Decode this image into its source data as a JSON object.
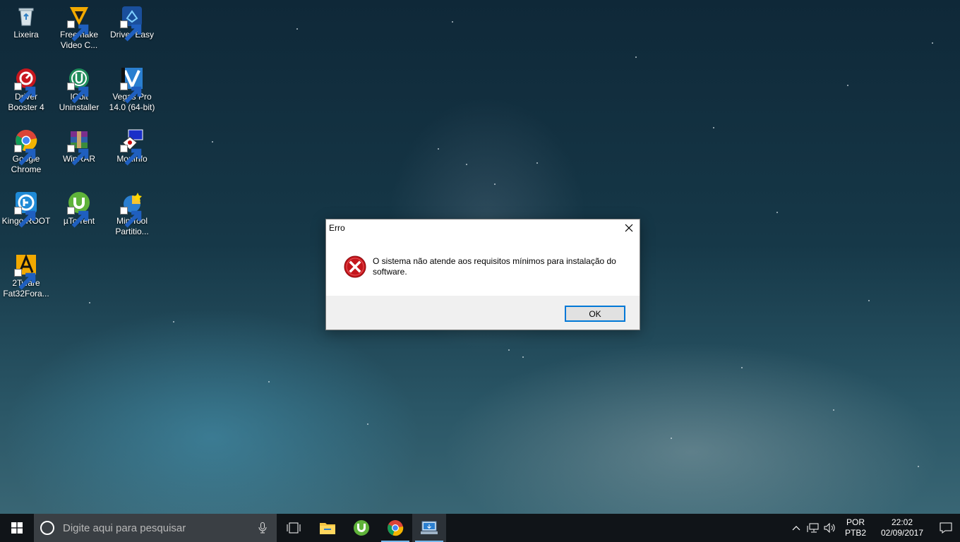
{
  "desktop": {
    "icons": [
      {
        "label": "Lixeira"
      },
      {
        "label": "Freemake Video C..."
      },
      {
        "label": "Driver Easy"
      },
      {
        "label": "Driver Booster 4"
      },
      {
        "label": "IObit Uninstaller"
      },
      {
        "label": "Vegas Pro 14.0 (64-bit)"
      },
      {
        "label": "Google Chrome"
      },
      {
        "label": "WinRAR"
      },
      {
        "label": "MonInfo"
      },
      {
        "label": "Kingo ROOT"
      },
      {
        "label": "µTorrent"
      },
      {
        "label": "MiniTool Partitio..."
      },
      {
        "label": "2Tware Fat32Fora..."
      }
    ]
  },
  "dialog": {
    "title": "Erro",
    "message": "O sistema não atende aos requisitos mínimos para instalação do software.",
    "ok_label": "OK",
    "icon": "error-icon"
  },
  "taskbar": {
    "search_placeholder": "Digite aqui para pesquisar",
    "pinned": [
      "file-explorer-icon",
      "utorrent-icon",
      "chrome-icon",
      "installer-icon"
    ],
    "language": {
      "line1": "POR",
      "line2": "PTB2"
    },
    "clock": {
      "time": "22:02",
      "date": "02/09/2017"
    }
  }
}
